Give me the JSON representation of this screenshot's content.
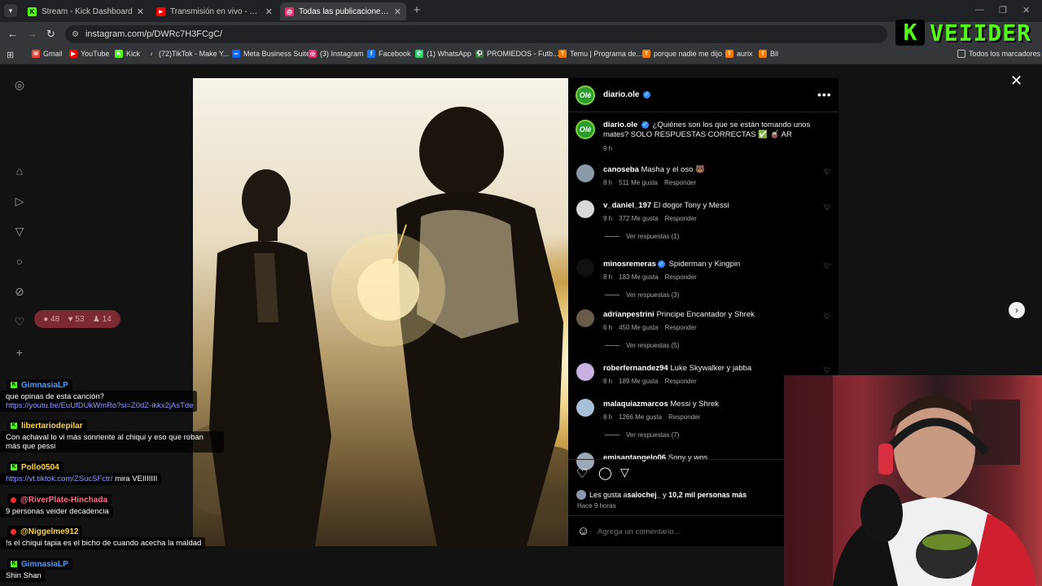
{
  "browser": {
    "tabs": [
      {
        "title": "Stream - Kick Dashboard",
        "favicon_color": "#53fc18",
        "favicon": "K",
        "active": false
      },
      {
        "title": "Transmisión en vivo - YouTube",
        "favicon_color": "#ff0000",
        "favicon": "▶",
        "active": false
      },
      {
        "title": "Todas las publicaciones • Instag",
        "favicon_color": "#e1306c",
        "favicon": "◎",
        "active": true
      }
    ],
    "url": "instagram.com/p/DWRc7H3FCgC/",
    "bookmarks": [
      {
        "label": "Gmail",
        "icon_color": "#ea4335",
        "icon": "M"
      },
      {
        "label": "YouTube",
        "icon_color": "#ff0000",
        "icon": "▶"
      },
      {
        "label": "Kick",
        "icon_color": "#53fc18",
        "icon": "K"
      },
      {
        "label": "(72)TikTok - Make Y...",
        "icon_color": "#333333",
        "icon": "♪"
      },
      {
        "label": "Meta Business Suite",
        "icon_color": "#0866ff",
        "icon": "∞"
      },
      {
        "label": "(3) Instagram",
        "icon_color": "#e1306c",
        "icon": "◎"
      },
      {
        "label": "Facebook",
        "icon_color": "#1877f2",
        "icon": "f"
      },
      {
        "label": "(1) WhatsApp",
        "icon_color": "#25d366",
        "icon": "✆"
      },
      {
        "label": "PROMIEDOS - Futb...",
        "icon_color": "#2e7d32",
        "icon": "⚽"
      },
      {
        "label": "Temu | Programa de...",
        "icon_color": "#f57c00",
        "icon": "T"
      },
      {
        "label": "porque nadie me dijo",
        "icon_color": "#f57c00",
        "icon": "T"
      },
      {
        "label": "aurix",
        "icon_color": "#f57c00",
        "icon": "T"
      },
      {
        "label": "Bil",
        "icon_color": "#f57c00",
        "icon": "T"
      }
    ],
    "all_bookmarks_label": "Todos los marcadores"
  },
  "instagram": {
    "notif_pill": {
      "comments": "48",
      "likes": "53",
      "follows": "14"
    },
    "post": {
      "author": "diario.ole",
      "caption": "¿Quiénes son los que se están tomando unos mates? SOLO RESPUESTAS CORRECTAS ✅ 🧉 AR",
      "caption_time": "9 h",
      "comments": [
        {
          "user": "canoseba",
          "verified": false,
          "text": "Masha y el oso 🐻",
          "time": "8 h",
          "likes": "511 Me gusta",
          "reply": "Responder",
          "view_replies": "",
          "avatar_color": "#8a9aa8"
        },
        {
          "user": "v_daniel_197",
          "verified": false,
          "text": "El dogor Tony y Messi",
          "time": "9 h",
          "likes": "372 Me gusta",
          "reply": "Responder",
          "view_replies": "Ver respuestas (1)",
          "avatar_color": "#d8d8d8"
        },
        {
          "user": "minosremeras",
          "verified": true,
          "text": "Spiderman y Kingpin",
          "time": "8 h",
          "likes": "183 Me gusta",
          "reply": "Responder",
          "view_replies": "Ver respuestas (3)",
          "avatar_color": "#111111"
        },
        {
          "user": "adrianpestrini",
          "verified": false,
          "text": "Principe Encantador y Shrek",
          "time": "6 h",
          "likes": "450 Me gusta",
          "reply": "Responder",
          "view_replies": "Ver respuestas (5)",
          "avatar_color": "#6a5a4a"
        },
        {
          "user": "roberfernandez94",
          "verified": false,
          "text": "Luke Skywalker y jabba",
          "time": "8 h",
          "likes": "189 Me gusta",
          "reply": "Responder",
          "view_replies": "",
          "avatar_color": "#c8b0e0"
        },
        {
          "user": "malaquiazmarcos",
          "verified": false,
          "text": "Messi y Shrek",
          "time": "8 h",
          "likes": "1266 Me gusta",
          "reply": "Responder",
          "view_replies": "Ver respuestas (7)",
          "avatar_color": "#a8c0d8"
        },
        {
          "user": "emisantangelo06",
          "verified": false,
          "text": "Sony y wos",
          "time": "",
          "likes": "",
          "reply": "",
          "view_replies": "",
          "avatar_color": "#9aa8b8"
        }
      ],
      "likes_summary_prefix": "Les gusta a ",
      "likes_summary_user": "salochej_",
      "likes_summary_middle": " y ",
      "likes_summary_count": "10,2 mil personas más",
      "posted_ago": "Hace 9 horas",
      "comment_placeholder": "Agrega un comentario..."
    }
  },
  "chat": [
    {
      "name": "GimnasiaLP",
      "name_color": "#4f9cff",
      "platform": "kick",
      "message": "que opinas de esta canción?",
      "link": "https://youtu.be/EuUfDUkWmRo?si=Z0dZ-ikkx2jAsTde",
      "link_after": ""
    },
    {
      "name": "libertariodepilar",
      "name_color": "#ffd43b",
      "platform": "kick",
      "message": "Con achaval lo vi más sonriente al chiqui y eso que roban más que pessi",
      "link": "",
      "link_after": ""
    },
    {
      "name": "Pollo0504",
      "name_color": "#ffd43b",
      "platform": "kick",
      "message": "",
      "link": "https://vt.tiktok.com/ZSucSFctr/",
      "link_after": " mira VEIIIIIII"
    },
    {
      "name": "@RiverPlate-Hinchada",
      "name_color": "#ff6b8b",
      "platform": "youtube",
      "message": "9 personas veider decadencia",
      "link": "",
      "link_after": ""
    },
    {
      "name": "@Niggelme912",
      "name_color": "#ffd43b",
      "platform": "youtube",
      "message": "!s el chiqui tapia es el bicho de cuando acecha la maldad",
      "link": "",
      "link_after": ""
    },
    {
      "name": "GimnasiaLP",
      "name_color": "#4f9cff",
      "platform": "kick",
      "message": "Shin Shan",
      "link": "",
      "link_after": ""
    }
  ],
  "overlay": {
    "logo_text": "VEIIDER",
    "logo_letter": "K"
  }
}
